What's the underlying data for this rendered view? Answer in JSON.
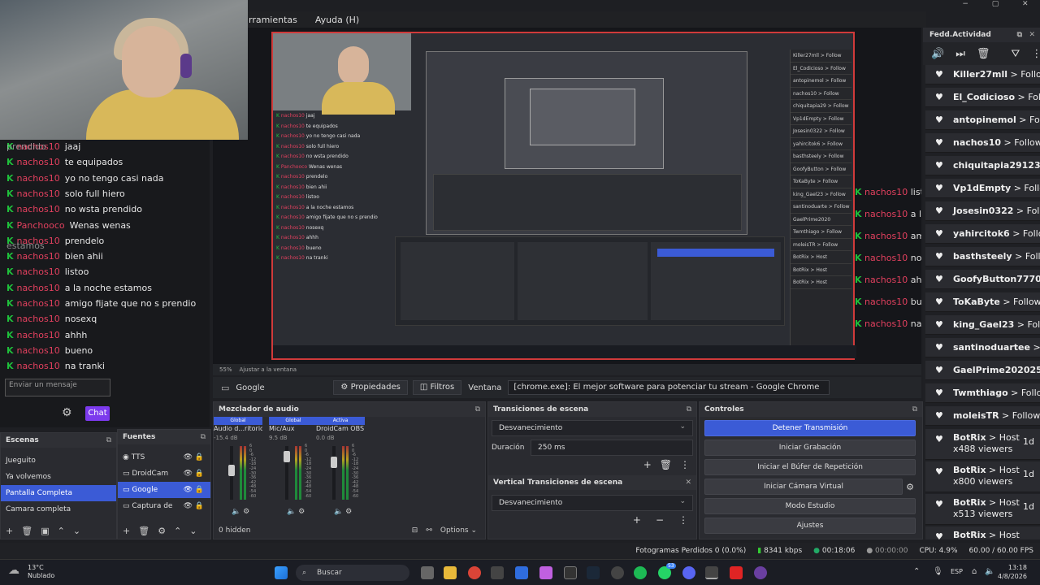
{
  "menu": {
    "items": [
      "rramientas",
      "Ayuda (H)"
    ]
  },
  "window_controls": [
    "−",
    "▢",
    "✕"
  ],
  "preview": {
    "zoom": "55%",
    "adjust": "Ajustar a la ventana",
    "nested_feed": [
      "Killer27mll > Follow",
      "El_Codicioso > Follow",
      "antopinemol > Follow",
      "nachos10 > Follow",
      "chiquitapia29 > Follow",
      "Vp1dEmpty > Follow",
      "Josesin0322 > Follow",
      "yahircitok6 > Follow",
      "basthsteely > Follow",
      "GoofyButton > Follow",
      "ToKaByte > Follow",
      "king_Gael23 > Follow",
      "santinoduarte > Follow",
      "GaelPrime2020",
      "Twmthiago > Follow",
      "moleisTR > Follow",
      "BotRix > Host",
      "BotRix > Host",
      "BotRix > Host"
    ],
    "nested_chat": [
      {
        "user": "nachos10",
        "msg": "listoo"
      },
      {
        "user": "nachos10",
        "msg": "a la noche estamos"
      },
      {
        "user": "nachos10",
        "msg": "amigo fijate que no s prendio"
      },
      {
        "user": "nachos10",
        "msg": "nosexq"
      },
      {
        "user": "nachos10",
        "msg": "ahhh"
      },
      {
        "user": "nachos10",
        "msg": "bueno"
      },
      {
        "user": "nachos10",
        "msg": "na tranki"
      }
    ]
  },
  "chat": {
    "lines": [
      {
        "user": "nachos10",
        "msg": "jaaj"
      },
      {
        "user": "nachos10",
        "msg": "te equipados"
      },
      {
        "user": "nachos10",
        "msg": "yo no tengo casi nada"
      },
      {
        "user": "nachos10",
        "msg": "solo full hiero"
      },
      {
        "user": "nachos10",
        "msg": "no wsta prendido"
      },
      {
        "user": "Panchooco",
        "msg": "Wenas wenas"
      },
      {
        "user": "nachos10",
        "msg": "prendelo"
      },
      {
        "user": "nachos10",
        "msg": "bien ahii"
      },
      {
        "user": "nachos10",
        "msg": "listoo"
      },
      {
        "user": "nachos10",
        "msg": "a la noche estamos"
      },
      {
        "user": "nachos10",
        "msg": "amigo fijate que no s prendio"
      },
      {
        "user": "nachos10",
        "msg": "nosexq"
      },
      {
        "user": "nachos10",
        "msg": "ahhh"
      },
      {
        "user": "nachos10",
        "msg": "bueno"
      },
      {
        "user": "nachos10",
        "msg": "na tranki"
      }
    ],
    "ghost_words": [
      "prendido",
      "estamos"
    ],
    "input_placeholder": "Enviar un mensaje",
    "send_label": "Chat"
  },
  "feed": {
    "title": "Fedd.Actividad",
    "items": [
      {
        "name": "Killer27mll",
        "action": "> Follow"
      },
      {
        "name": "El_Codicioso",
        "action": "> Follow"
      },
      {
        "name": "antopinemol",
        "action": "> Follow"
      },
      {
        "name": "nachos10",
        "action": "> Follow"
      },
      {
        "name": "chiquitapia29123",
        "action": "> Follow"
      },
      {
        "name": "Vp1dEmpty",
        "action": "> Follow"
      },
      {
        "name": "Josesin0322",
        "action": "> Follow"
      },
      {
        "name": "yahircitok6",
        "action": "> Follow"
      },
      {
        "name": "basthsteely",
        "action": "> Follow"
      },
      {
        "name": "GoofyButton7770",
        "action": ">"
      },
      {
        "name": "ToKaByte",
        "action": "> Follow"
      },
      {
        "name": "king_Gael23",
        "action": "> Follow"
      },
      {
        "name": "santinoduartee",
        "action": "> Follow"
      },
      {
        "name": "GaelPrime2020250",
        "action": ""
      },
      {
        "name": "Twmthiago",
        "action": "> Follow"
      },
      {
        "name": "moleisTR",
        "action": "> Follow"
      }
    ],
    "hosts": [
      {
        "name": "BotRix",
        "line1": "> Host",
        "line2": "x488 viewers",
        "time": "1d"
      },
      {
        "name": "BotRix",
        "line1": "> Host",
        "line2": "x800 viewers",
        "time": "1d"
      },
      {
        "name": "BotRix",
        "line1": "> Host",
        "line2": "x513 viewers",
        "time": "1d"
      },
      {
        "name": "BotRix",
        "line1": "> Host",
        "line2": "",
        "time": ""
      }
    ]
  },
  "source_bar": {
    "source": "Google",
    "props": "Propiedades",
    "filters": "Filtros",
    "window_label": "Ventana",
    "window_value": "[chrome.exe]: El mejor software para potenciar tu stream - Google Chrome"
  },
  "scenes": {
    "title": "Escenas",
    "items": [
      "Jueguito",
      "Ya volvemos",
      "Pantalla Completa",
      "Camara completa"
    ],
    "selected": 2
  },
  "sources": {
    "title": "Fuentes",
    "items": [
      "TTS",
      "DroidCam",
      "Google",
      "Captura de"
    ],
    "selected": 2
  },
  "mixer": {
    "title": "Mezclador de audio",
    "channels": [
      {
        "tag": "Global",
        "name": "Audio d...ritorio",
        "db": "-15.4 dB",
        "level": 0.55
      },
      {
        "tag": "Global",
        "name": "Mic/Aux",
        "db": "9.5 dB",
        "level": 0.8
      },
      {
        "tag": "Activa",
        "name": "DroidCam OBS 2",
        "db": "0.0 dB",
        "level": 0.7
      }
    ],
    "scale": [
      "6",
      "0",
      "-6",
      "-12",
      "-18",
      "-24",
      "-30",
      "-36",
      "-42",
      "-48",
      "-54",
      "-60"
    ],
    "hidden": "0 hidden",
    "options": "Options"
  },
  "transitions": {
    "title": "Transiciones de escena",
    "current": "Desvanecimiento",
    "duration_label": "Duración",
    "duration_value": "250 ms",
    "vertical_title": "Vertical Transiciones de escena",
    "vertical_current": "Desvanecimiento"
  },
  "controls": {
    "title": "Controles",
    "buttons": [
      "Detener Transmisión",
      "Iniciar Grabación",
      "Iniciar el Búfer de Repetición",
      "Iniciar Cámara Virtual",
      "Modo Estudio",
      "Ajustes"
    ]
  },
  "status": {
    "dropped": "Fotogramas Perdidos 0 (0.0%)",
    "bitrate": "8341 kbps",
    "live": "00:18:06",
    "rec": "00:00:00",
    "cpu": "CPU: 4.9%",
    "fps": "60.00 / 60.00 FPS"
  },
  "taskbar": {
    "weather_temp": "13°C",
    "weather_desc": "Nublado",
    "search": "Buscar",
    "lang": "ESP",
    "time": "13:18",
    "date": "4/8/2026",
    "badge": "53"
  }
}
